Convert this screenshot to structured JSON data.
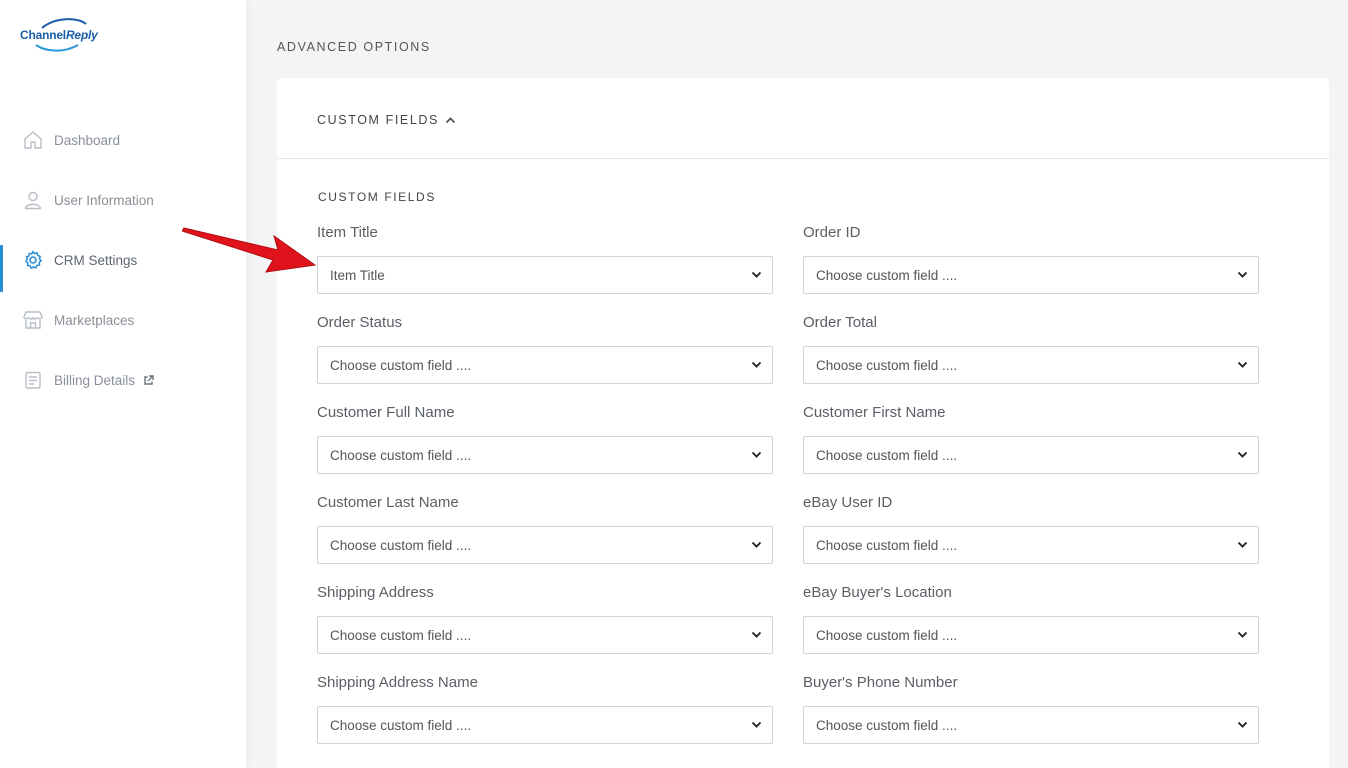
{
  "brand": {
    "part1": "Channel",
    "part2": "Reply"
  },
  "sidebar": {
    "items": [
      {
        "label": "Dashboard",
        "icon": "home-icon",
        "active": false
      },
      {
        "label": "User Information",
        "icon": "user-icon",
        "active": false
      },
      {
        "label": "CRM Settings",
        "icon": "gear-icon",
        "active": true
      },
      {
        "label": "Marketplaces",
        "icon": "store-icon",
        "active": false
      },
      {
        "label": "Billing Details",
        "icon": "billing-icon",
        "active": false,
        "external": true
      }
    ]
  },
  "main": {
    "section_title": "ADVANCED OPTIONS",
    "card_title": "CUSTOM FIELDS",
    "sub_title": "CUSTOM FIELDS",
    "fields": [
      {
        "label": "Item Title",
        "value": "Item Title"
      },
      {
        "label": "Order ID",
        "value": "Choose custom field ...."
      },
      {
        "label": "Order Status",
        "value": "Choose custom field ...."
      },
      {
        "label": "Order Total",
        "value": "Choose custom field ...."
      },
      {
        "label": "Customer Full Name",
        "value": "Choose custom field ...."
      },
      {
        "label": "Customer First Name",
        "value": "Choose custom field ...."
      },
      {
        "label": "Customer Last Name",
        "value": "Choose custom field ...."
      },
      {
        "label": "eBay User ID",
        "value": "Choose custom field ...."
      },
      {
        "label": "Shipping Address",
        "value": "Choose custom field ...."
      },
      {
        "label": "eBay Buyer's Location",
        "value": "Choose custom field ...."
      },
      {
        "label": "Shipping Address Name",
        "value": "Choose custom field ...."
      },
      {
        "label": "Buyer's Phone Number",
        "value": "Choose custom field ...."
      }
    ]
  },
  "colors": {
    "accent": "#2b8fd6",
    "arrow": "#e0121b",
    "brand": "#1a5ea8"
  }
}
